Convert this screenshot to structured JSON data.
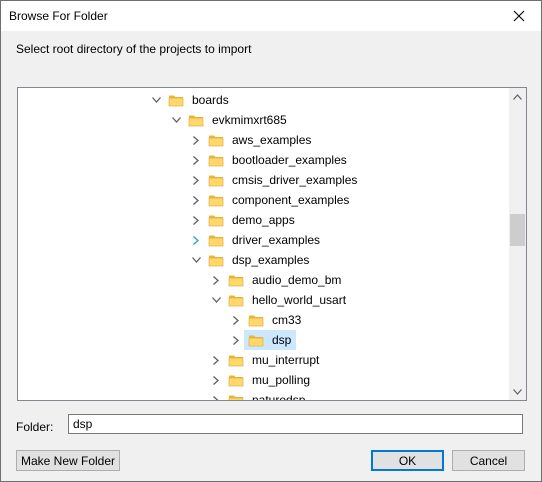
{
  "window": {
    "title": "Browse For Folder"
  },
  "prompt": "Select root directory of the projects to import",
  "tree": {
    "items": [
      {
        "label": "boards",
        "state": "expanded"
      },
      {
        "label": "evkmimxrt685",
        "state": "expanded"
      },
      {
        "label": "aws_examples",
        "state": "collapsed"
      },
      {
        "label": "bootloader_examples",
        "state": "collapsed"
      },
      {
        "label": "cmsis_driver_examples",
        "state": "collapsed"
      },
      {
        "label": "component_examples",
        "state": "collapsed"
      },
      {
        "label": "demo_apps",
        "state": "collapsed"
      },
      {
        "label": "driver_examples",
        "state": "collapsed-hover"
      },
      {
        "label": "dsp_examples",
        "state": "expanded"
      },
      {
        "label": "audio_demo_bm",
        "state": "collapsed"
      },
      {
        "label": "hello_world_usart",
        "state": "expanded"
      },
      {
        "label": "cm33",
        "state": "collapsed"
      },
      {
        "label": "dsp",
        "state": "collapsed",
        "selected": true
      },
      {
        "label": "mu_interrupt",
        "state": "collapsed"
      },
      {
        "label": "mu_polling",
        "state": "collapsed"
      },
      {
        "label": "naturedsp",
        "state": "collapsed"
      }
    ]
  },
  "folder": {
    "label": "Folder:",
    "value": "dsp"
  },
  "buttons": {
    "make_new_folder": "Make New Folder",
    "ok": "OK",
    "cancel": "Cancel"
  },
  "colors": {
    "folder_fill": "#ffd76a",
    "folder_tab": "#e8b83a",
    "selection": "#cce8ff",
    "accent": "#0078d7"
  }
}
